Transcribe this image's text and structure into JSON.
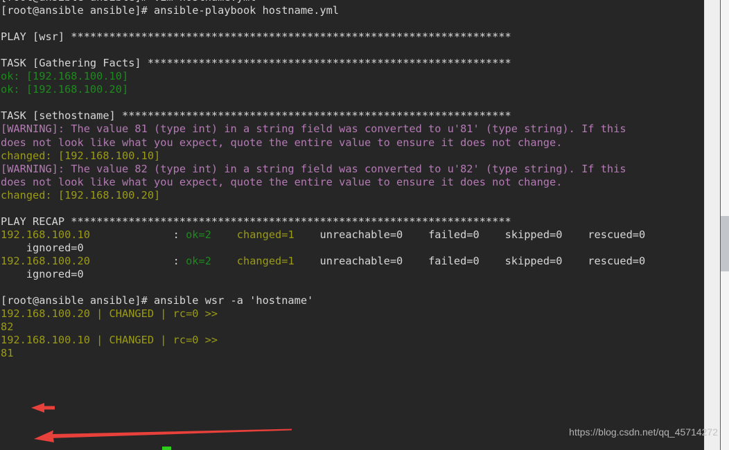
{
  "terminal": {
    "background": "#262626",
    "foreground": "#d8d8d8",
    "colors": {
      "green": "#1e8a1e",
      "olive": "#9b9b15",
      "purple": "#b57ab5",
      "arrow_red": "#e8403a",
      "cursor_green": "#2ecc1c"
    },
    "lines": [
      {
        "id": "l00",
        "segments": [
          {
            "text": "[root@ansible ansible]# vim hostname.yml",
            "color": "white"
          }
        ]
      },
      {
        "id": "l01",
        "segments": [
          {
            "text": "[root@ansible ansible]# ansible-playbook hostname.yml",
            "color": "white"
          }
        ]
      },
      {
        "id": "l02",
        "segments": [
          {
            "text": "",
            "color": "white"
          }
        ]
      },
      {
        "id": "l03",
        "segments": [
          {
            "text": "PLAY [wsr] *********************************************************************",
            "color": "white"
          }
        ]
      },
      {
        "id": "l04",
        "segments": [
          {
            "text": "",
            "color": "white"
          }
        ]
      },
      {
        "id": "l05",
        "segments": [
          {
            "text": "TASK [Gathering Facts] *********************************************************",
            "color": "white"
          }
        ]
      },
      {
        "id": "l06",
        "segments": [
          {
            "text": "ok: [192.168.100.10]",
            "color": "green"
          }
        ]
      },
      {
        "id": "l07",
        "segments": [
          {
            "text": "ok: [192.168.100.20]",
            "color": "green"
          }
        ]
      },
      {
        "id": "l08",
        "segments": [
          {
            "text": "",
            "color": "white"
          }
        ]
      },
      {
        "id": "l09",
        "segments": [
          {
            "text": "TASK [sethostname] *************************************************************",
            "color": "white"
          }
        ]
      },
      {
        "id": "l10",
        "segments": [
          {
            "text": "[WARNING]: The value 81 (type int) in a string field was converted to u'81' (type string). If this",
            "color": "purple"
          }
        ]
      },
      {
        "id": "l11",
        "segments": [
          {
            "text": "does not look like what you expect, quote the entire value to ensure it does not change.",
            "color": "purple"
          }
        ]
      },
      {
        "id": "l12",
        "segments": [
          {
            "text": "changed: [192.168.100.10]",
            "color": "olive"
          }
        ]
      },
      {
        "id": "l13",
        "segments": [
          {
            "text": "[WARNING]: The value 82 (type int) in a string field was converted to u'82' (type string). If this",
            "color": "purple"
          }
        ]
      },
      {
        "id": "l14",
        "segments": [
          {
            "text": "does not look like what you expect, quote the entire value to ensure it does not change.",
            "color": "purple"
          }
        ]
      },
      {
        "id": "l15",
        "segments": [
          {
            "text": "changed: [192.168.100.20]",
            "color": "olive"
          }
        ]
      },
      {
        "id": "l16",
        "segments": [
          {
            "text": "",
            "color": "white"
          }
        ]
      },
      {
        "id": "l17",
        "segments": [
          {
            "text": "PLAY RECAP *********************************************************************",
            "color": "white"
          }
        ]
      },
      {
        "id": "l18",
        "segments": [
          {
            "text": "192.168.100.10",
            "color": "olive"
          },
          {
            "text": "             : ",
            "color": "white"
          },
          {
            "text": "ok=2",
            "color": "green"
          },
          {
            "text": "    ",
            "color": "white"
          },
          {
            "text": "changed=1",
            "color": "olive"
          },
          {
            "text": "    unreachable=0    failed=0    skipped=0    rescued=0",
            "color": "white"
          }
        ]
      },
      {
        "id": "l19",
        "segments": [
          {
            "text": "    ignored=0",
            "color": "white"
          }
        ]
      },
      {
        "id": "l20",
        "segments": [
          {
            "text": "192.168.100.20",
            "color": "olive"
          },
          {
            "text": "             : ",
            "color": "white"
          },
          {
            "text": "ok=2",
            "color": "green"
          },
          {
            "text": "    ",
            "color": "white"
          },
          {
            "text": "changed=1",
            "color": "olive"
          },
          {
            "text": "    unreachable=0    failed=0    skipped=0    rescued=0",
            "color": "white"
          }
        ]
      },
      {
        "id": "l21",
        "segments": [
          {
            "text": "    ignored=0",
            "color": "white"
          }
        ]
      },
      {
        "id": "l22",
        "segments": [
          {
            "text": "",
            "color": "white"
          }
        ]
      },
      {
        "id": "l23",
        "segments": [
          {
            "text": "[root@ansible ansible]# ansible wsr -a 'hostname'",
            "color": "white"
          }
        ]
      },
      {
        "id": "l24",
        "segments": [
          {
            "text": "192.168.100.20 | CHANGED | rc=0 >>",
            "color": "olive"
          }
        ]
      },
      {
        "id": "l25",
        "segments": [
          {
            "text": "82",
            "color": "olive"
          }
        ]
      },
      {
        "id": "l26",
        "segments": [
          {
            "text": "192.168.100.10 | CHANGED | rc=0 >>",
            "color": "olive"
          }
        ]
      },
      {
        "id": "l27",
        "segments": [
          {
            "text": "81",
            "color": "olive"
          }
        ]
      }
    ]
  },
  "annotations": {
    "arrow_short": {
      "label": "arrow-pointing-to-82"
    },
    "arrow_long": {
      "label": "arrow-pointing-to-81"
    }
  },
  "watermark": {
    "text": "https://blog.csdn.net/qq_45714272"
  },
  "scrollbar": {
    "position": "right",
    "thumb_state": "middle"
  }
}
